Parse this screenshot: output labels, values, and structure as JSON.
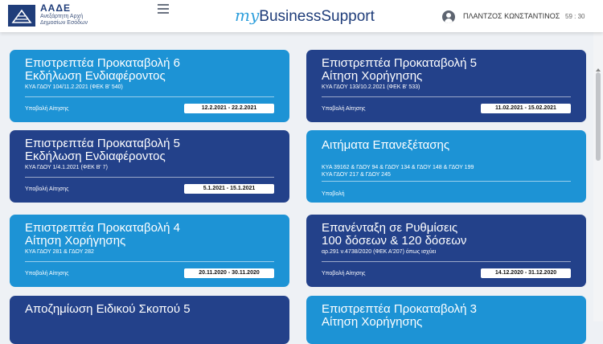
{
  "header": {
    "logo_abbr": "ΑΑΔΕ",
    "logo_sub_line1": "Ανεξάρτητη Αρχή",
    "logo_sub_line2": "Δημοσίων Εσόδων",
    "brand_my": "my",
    "brand_name": "BusinessSupport",
    "user_name": "ΠΛΑΝΤΖΟΣ ΚΩΝΣΤΑΝΤΙΝΟΣ",
    "timer": "59 : 30"
  },
  "cards": [
    {
      "title_line1": "Επιστρεπτέα Προκαταβολή 6",
      "title_line2": "Εκδήλωση Ενδιαφέροντος",
      "law": "ΚΥΑ ΓΔΟΥ 104/11.2.2021 (ΦΕΚ Β' 540)",
      "submit_label": "Υποβολή Αίτησης",
      "dates": "12.2.2021 - 22.2.2021"
    },
    {
      "title_line1": "Επιστρεπτέα Προκαταβολή 5",
      "title_line2": "Αίτηση Χορήγησης",
      "law": "ΚΥΑ ΓΔΟΥ 133/10.2.2021 (ΦΕΚ Β' 533)",
      "submit_label": "Υποβολή Αίτησης",
      "dates": "11.02.2021 - 15.02.2021"
    },
    {
      "title_line1": "Επιστρεπτέα Προκαταβολή 5",
      "title_line2": "Εκδήλωση Ενδιαφέροντος",
      "law": "ΚΥΑ ΓΔΟΥ 1/4.1.2021 (ΦΕΚ Β' 7)",
      "submit_label": "Υποβολή Αίτησης",
      "dates": "5.1.2021 - 15.1.2021"
    },
    {
      "title_line1": "Αιτήματα Επανεξέτασης",
      "law_line1": "ΚΥΑ 39162 & ΓΔΟΥ 94 & ΓΔΟΥ 134 & ΓΔΟΥ 148 & ΓΔΟΥ 199",
      "law_line2": "ΚΥΑ ΓΔΟΥ 217 & ΓΔΟΥ 245",
      "submit_label": "Υποβολή"
    },
    {
      "title_line1": "Επιστρεπτέα Προκαταβολή 4",
      "title_line2": "Αίτηση Χορήγησης",
      "law": "ΚΥΑ ΓΔΟΥ 281 & ΓΔΟΥ 282",
      "submit_label": "Υποβολή Αίτησης",
      "dates": "20.11.2020 - 30.11.2020"
    },
    {
      "title_line1": "Επανένταξη σε Ρυθμίσεις",
      "title_line2": "100 δόσεων & 120 δόσεων",
      "law": "αρ.291 ν.4738/2020 (ΦΕΚ Α'207) όπως ισχύει",
      "submit_label": "Υποβολή Αίτησης",
      "dates": "14.12.2020 - 31.12.2020"
    },
    {
      "title_line1": "Αποζημίωση Ειδικού Σκοπού 5"
    },
    {
      "title_line1": "Επιστρεπτέα Προκαταβολή 3",
      "title_line2": "Αίτηση Χορήγησης"
    }
  ]
}
